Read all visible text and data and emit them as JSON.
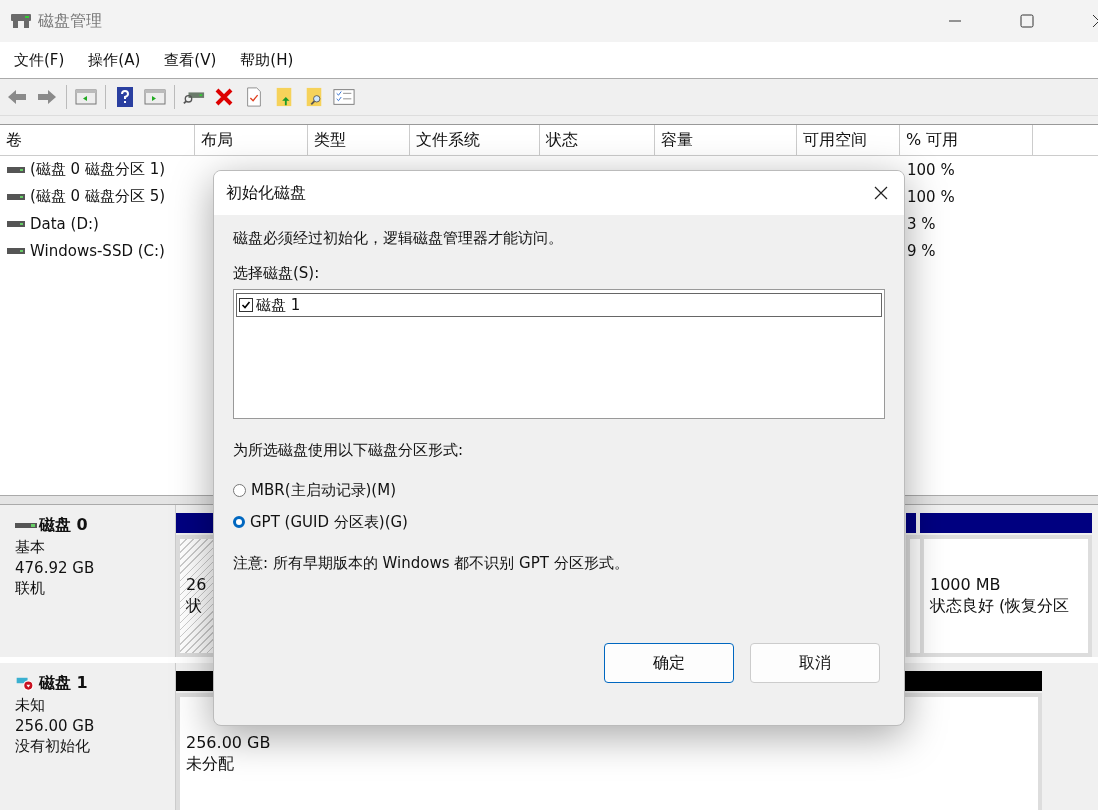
{
  "window": {
    "title": "磁盘管理"
  },
  "menu": [
    "文件(F)",
    "操作(A)",
    "查看(V)",
    "帮助(H)"
  ],
  "table": {
    "columns": [
      "卷",
      "布局",
      "类型",
      "文件系统",
      "状态",
      "容量",
      "可用空间",
      "% 可用"
    ],
    "rows": [
      {
        "volume": "(磁盘 0 磁盘分区 1)",
        "percent_free": "100 %"
      },
      {
        "volume": "(磁盘 0 磁盘分区 5)",
        "percent_free": "100 %"
      },
      {
        "volume": "Data (D:)",
        "percent_free": "3 %"
      },
      {
        "volume": "Windows-SSD (C:)",
        "percent_free": "9 %"
      }
    ]
  },
  "disks": [
    {
      "name": "磁盘 0",
      "kind": "basic",
      "type": "基本",
      "size": "476.92 GB",
      "status": "联机",
      "partitions": [
        {
          "color": "#000080",
          "hatched": true,
          "lines": [
            "26",
            "状"
          ]
        },
        {
          "color": "#000080",
          "hatched": false
        },
        {
          "color": "#000080",
          "hatched": false,
          "lines": [
            "1000 MB",
            "状态良好 (恢复分区"
          ]
        }
      ]
    },
    {
      "name": "磁盘 1",
      "kind": "unknown",
      "type": "未知",
      "size": "256.00 GB",
      "status": "没有初始化",
      "partitions": [
        {
          "color": "#000000",
          "hatched": false,
          "lines": [
            "256.00 GB",
            "未分配"
          ]
        }
      ]
    }
  ],
  "dialog": {
    "title": "初始化磁盘",
    "message": "磁盘必须经过初始化，逻辑磁盘管理器才能访问。",
    "select_label": "选择磁盘(S):",
    "disks": [
      {
        "label": "磁盘 1",
        "checked": true,
        "selected": true
      }
    ],
    "style_label": "为所选磁盘使用以下磁盘分区形式:",
    "options": [
      {
        "label": "MBR(主启动记录)(M)",
        "selected": false
      },
      {
        "label": "GPT (GUID 分区表)(G)",
        "selected": true
      }
    ],
    "note": "注意: 所有早期版本的 Windows 都不识别 GPT 分区形式。",
    "buttons": [
      {
        "label": "确定",
        "default": true
      },
      {
        "label": "取消",
        "default": false
      }
    ]
  }
}
